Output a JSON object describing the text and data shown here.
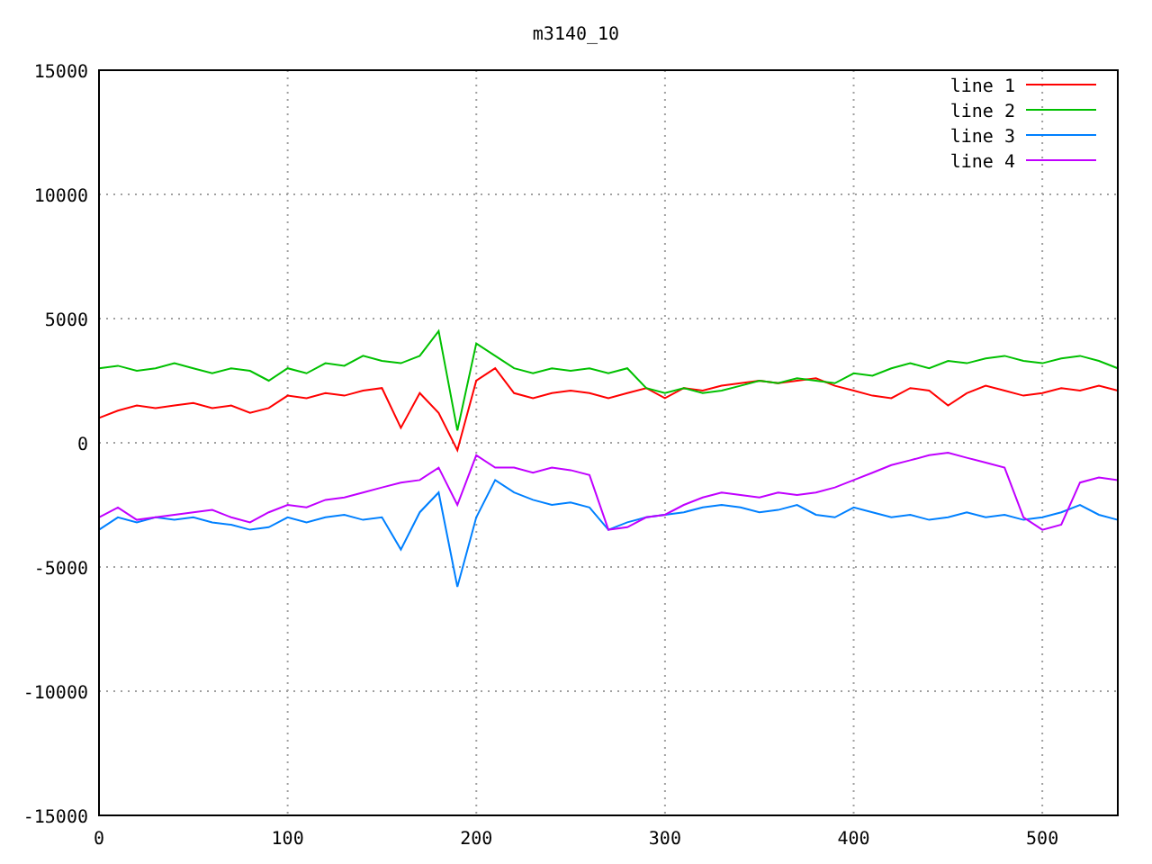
{
  "chart_data": {
    "type": "line",
    "title": "m3140_10",
    "grid": true,
    "legend": true,
    "xlim": [
      0,
      540
    ],
    "ylim": [
      -15000,
      15000
    ],
    "xticks": [
      0,
      100,
      200,
      300,
      400,
      500
    ],
    "yticks": [
      -15000,
      -10000,
      -5000,
      0,
      5000,
      10000,
      15000
    ],
    "x": [
      0,
      10,
      20,
      30,
      40,
      50,
      60,
      70,
      80,
      90,
      100,
      110,
      120,
      130,
      140,
      150,
      160,
      170,
      180,
      190,
      200,
      210,
      220,
      230,
      240,
      250,
      260,
      270,
      280,
      290,
      300,
      310,
      320,
      330,
      340,
      350,
      360,
      370,
      380,
      390,
      400,
      410,
      420,
      430,
      440,
      450,
      460,
      470,
      480,
      490,
      500,
      510,
      520,
      530,
      540
    ],
    "series": [
      {
        "name": "line 1",
        "color": "#ff0000",
        "values": [
          1000,
          1300,
          1500,
          1400,
          1500,
          1600,
          1400,
          1500,
          1200,
          1400,
          1900,
          1800,
          2000,
          1900,
          2100,
          2200,
          600,
          2000,
          1200,
          -300,
          2500,
          3000,
          2000,
          1800,
          2000,
          2100,
          2000,
          1800,
          2000,
          2200,
          1800,
          2200,
          2100,
          2300,
          2400,
          2500,
          2400,
          2500,
          2600,
          2300,
          2100,
          1900,
          1800,
          2200,
          2100,
          1500,
          2000,
          2300,
          2100,
          1900,
          2000,
          2200,
          2100,
          2300,
          2100
        ]
      },
      {
        "name": "line 2",
        "color": "#00c000",
        "values": [
          3000,
          3100,
          2900,
          3000,
          3200,
          3000,
          2800,
          3000,
          2900,
          2500,
          3000,
          2800,
          3200,
          3100,
          3500,
          3300,
          3200,
          3500,
          4500,
          500,
          4000,
          3500,
          3000,
          2800,
          3000,
          2900,
          3000,
          2800,
          3000,
          2200,
          2000,
          2200,
          2000,
          2100,
          2300,
          2500,
          2400,
          2600,
          2500,
          2400,
          2800,
          2700,
          3000,
          3200,
          3000,
          3300,
          3200,
          3400,
          3500,
          3300,
          3200,
          3400,
          3500,
          3300,
          3000
        ]
      },
      {
        "name": "line 3",
        "color": "#0080ff",
        "values": [
          -3500,
          -3000,
          -3200,
          -3000,
          -3100,
          -3000,
          -3200,
          -3300,
          -3500,
          -3400,
          -3000,
          -3200,
          -3000,
          -2900,
          -3100,
          -3000,
          -4300,
          -2800,
          -2000,
          -5800,
          -3000,
          -1500,
          -2000,
          -2300,
          -2500,
          -2400,
          -2600,
          -3500,
          -3200,
          -3000,
          -2900,
          -2800,
          -2600,
          -2500,
          -2600,
          -2800,
          -2700,
          -2500,
          -2900,
          -3000,
          -2600,
          -2800,
          -3000,
          -2900,
          -3100,
          -3000,
          -2800,
          -3000,
          -2900,
          -3100,
          -3000,
          -2800,
          -2500,
          -2900,
          -3100
        ]
      },
      {
        "name": "line 4",
        "color": "#c000ff",
        "values": [
          -3000,
          -2600,
          -3100,
          -3000,
          -2900,
          -2800,
          -2700,
          -3000,
          -3200,
          -2800,
          -2500,
          -2600,
          -2300,
          -2200,
          -2000,
          -1800,
          -1600,
          -1500,
          -1000,
          -2500,
          -500,
          -1000,
          -1000,
          -1200,
          -1000,
          -1100,
          -1300,
          -3500,
          -3400,
          -3000,
          -2900,
          -2500,
          -2200,
          -2000,
          -2100,
          -2200,
          -2000,
          -2100,
          -2000,
          -1800,
          -1500,
          -1200,
          -900,
          -700,
          -500,
          -400,
          -600,
          -800,
          -1000,
          -3000,
          -3500,
          -3300,
          -1600,
          -1400,
          -1500
        ]
      }
    ]
  }
}
